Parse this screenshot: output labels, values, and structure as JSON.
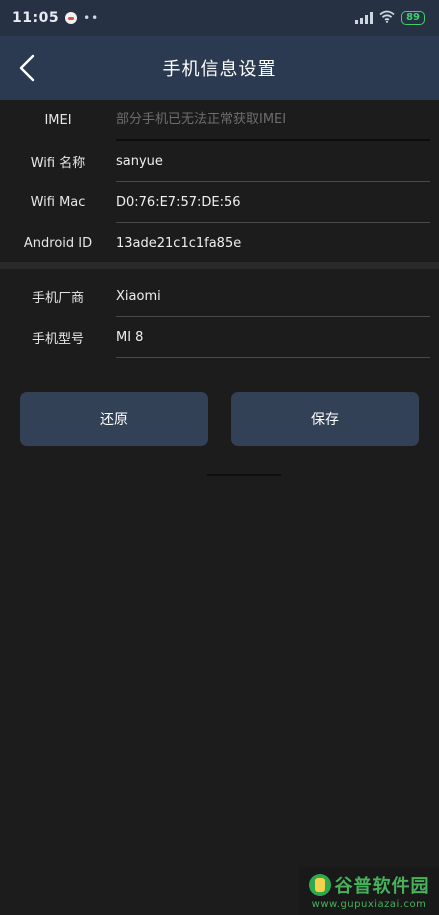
{
  "status_bar": {
    "time": "11:05",
    "dots": "••",
    "battery": "89",
    "app_icon": "qq-bird-icon",
    "signal_icon": "signal-icon",
    "wifi_icon": "wifi-icon",
    "battery_icon": "battery-icon"
  },
  "app_bar": {
    "title": "手机信息设置",
    "back_icon": "chevron-left-icon"
  },
  "form": {
    "imei": {
      "label": "IMEI",
      "value": "",
      "placeholder": "部分手机已无法正常获取IMEI"
    },
    "wifi_name": {
      "label": "Wifi 名称",
      "value": "sanyue"
    },
    "wifi_mac": {
      "label": "Wifi Mac",
      "value": "D0:76:E7:57:DE:56"
    },
    "android_id": {
      "label": "Android ID",
      "value": "13ade21c1c1fa85e"
    },
    "manufacturer": {
      "label": "手机厂商",
      "value": "Xiaomi"
    },
    "model": {
      "label": "手机型号",
      "value": "MI 8"
    }
  },
  "buttons": {
    "restore": "还原",
    "save": "保存"
  },
  "watermark": {
    "name": "谷普软件园",
    "url": "www.gupuxiazai.com"
  },
  "colors": {
    "app_bar": "#2b3a50",
    "status_bar": "#263243",
    "background": "#1c1c1d",
    "button": "#334157",
    "battery": "#3ecf6b"
  }
}
